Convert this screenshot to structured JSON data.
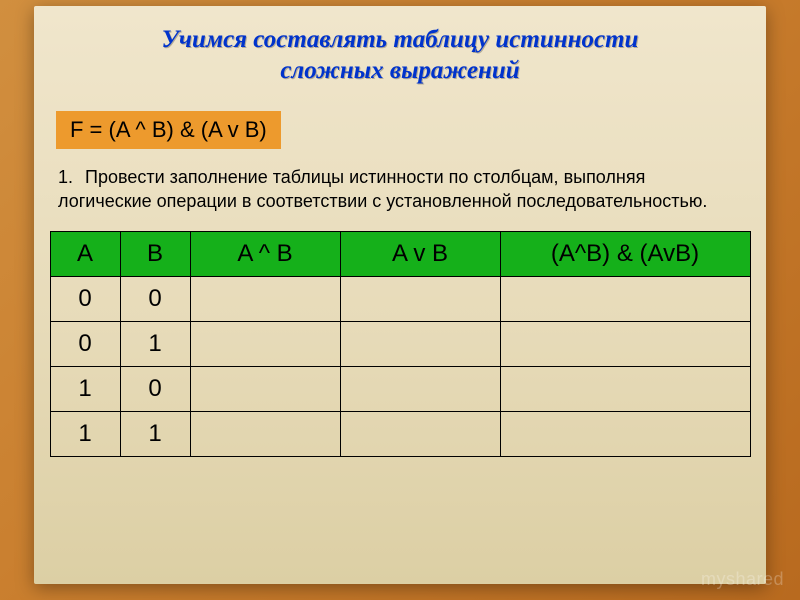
{
  "title_line1": "Учимся составлять таблицу истинности",
  "title_line2": "сложных выражений",
  "formula": "F = (A ^ B) & (A v B)",
  "instruction_number": "1.",
  "instruction_text": "Провести заполнение таблицы истинности по столбцам, выполняя логические операции в соответствии с установленной последовательностью.",
  "watermark": "myshared",
  "table": {
    "headers": [
      "A",
      "B",
      "A ^ B",
      "A v B",
      "(A^B) & (AvB)"
    ],
    "rows": [
      [
        "0",
        "0",
        "",
        "",
        ""
      ],
      [
        "0",
        "1",
        "",
        "",
        ""
      ],
      [
        "1",
        "0",
        "",
        "",
        ""
      ],
      [
        "1",
        "1",
        "",
        "",
        ""
      ]
    ]
  }
}
